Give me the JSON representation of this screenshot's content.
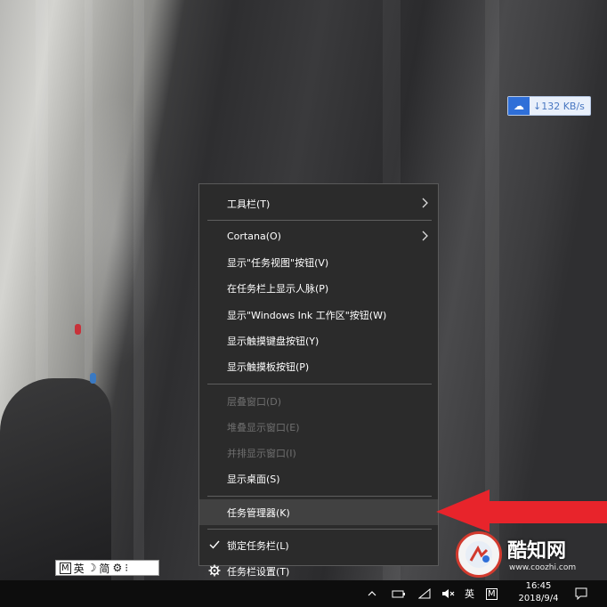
{
  "speed_widget": {
    "text": "↓132 KB/s"
  },
  "menu": {
    "items": [
      {
        "label": "工具栏(T)",
        "submenu": true,
        "enabled": true
      },
      {
        "label": "Cortana(O)",
        "submenu": true,
        "enabled": true
      },
      {
        "label": "显示\"任务视图\"按钮(V)",
        "enabled": true
      },
      {
        "label": "在任务栏上显示人脉(P)",
        "enabled": true
      },
      {
        "label": "显示\"Windows Ink 工作区\"按钮(W)",
        "enabled": true
      },
      {
        "label": "显示触摸键盘按钮(Y)",
        "enabled": true
      },
      {
        "label": "显示触摸板按钮(P)",
        "enabled": true
      },
      {
        "label": "层叠窗口(D)",
        "enabled": false
      },
      {
        "label": "堆叠显示窗口(E)",
        "enabled": false
      },
      {
        "label": "并排显示窗口(I)",
        "enabled": false
      },
      {
        "label": "显示桌面(S)",
        "enabled": true
      },
      {
        "label": "任务管理器(K)",
        "enabled": true,
        "highlighted": true
      },
      {
        "label": "锁定任务栏(L)",
        "enabled": true,
        "checked": true
      },
      {
        "label": "任务栏设置(T)",
        "enabled": true,
        "icon": "gear-icon"
      }
    ]
  },
  "watermark": {
    "title": "酷知网",
    "url": "www.coozhi.com"
  },
  "ime_bar": {
    "mode_box": "M",
    "lang": "英",
    "moon": "☽",
    "charset": "简",
    "settings": "⚙",
    "more": "⁝"
  },
  "taskbar": {
    "lang": "英",
    "ime_box": "M",
    "time": "16:45",
    "date": "2018/9/4"
  },
  "colors": {
    "accent_arrow": "#e8242b",
    "menu_bg": "#2b2b2b",
    "highlight": "#414141"
  }
}
